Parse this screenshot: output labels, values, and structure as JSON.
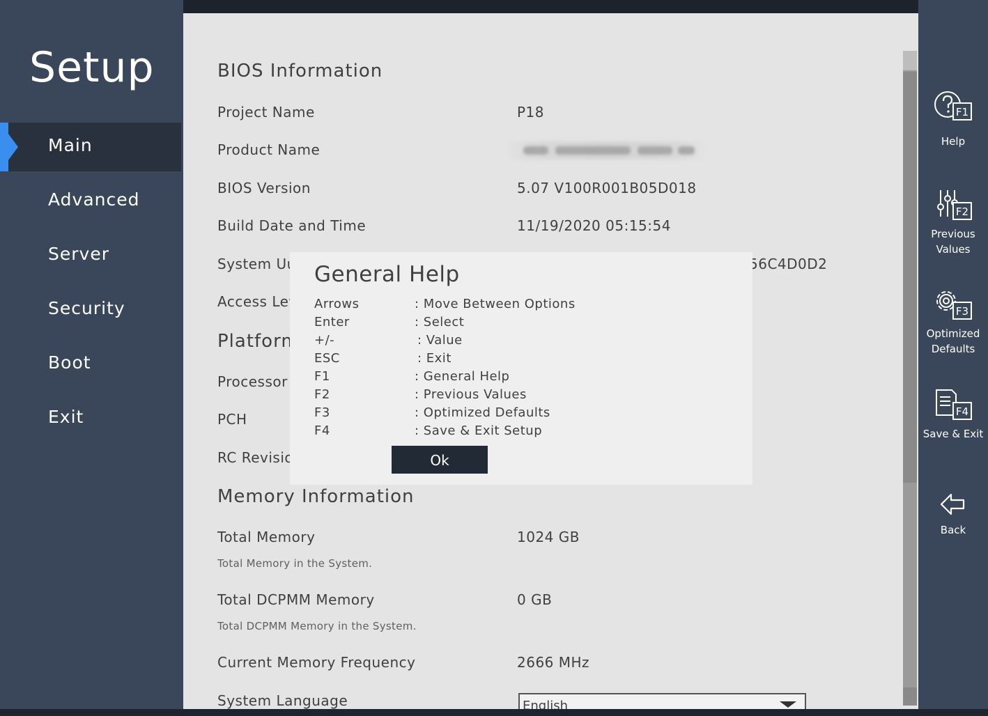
{
  "sidebar": {
    "title": "Setup",
    "items": [
      {
        "label": "Main",
        "active": true
      },
      {
        "label": "Advanced"
      },
      {
        "label": "Server"
      },
      {
        "label": "Security"
      },
      {
        "label": "Boot"
      },
      {
        "label": "Exit"
      }
    ]
  },
  "main": {
    "bios_section": "BIOS Information",
    "project_name_label": "Project Name",
    "project_name_value": "P18",
    "product_name_label": "Product Name",
    "bios_version_label": "BIOS Version",
    "bios_version_value": "5.07 V100R001B05D018",
    "build_date_label": "Build Date and Time",
    "build_date_value": "11/19/2020 05:15:54",
    "system_uuid_label": "System Uu",
    "system_uuid_value": "56C4D0D2",
    "access_level_label": "Access Lev",
    "platform_section": "Platform",
    "processor_label": "Processor",
    "pch_label": "PCH",
    "rc_revision_label": "RC Revisio",
    "memory_section": "Memory Information",
    "total_memory_label": "Total Memory",
    "total_memory_value": "1024 GB",
    "total_memory_desc": "Total Memory in the System.",
    "total_dcpmm_label": "Total DCPMM Memory",
    "total_dcpmm_value": "0 GB",
    "total_dcpmm_desc": "Total DCPMM Memory in the System.",
    "mem_freq_label": "Current Memory Frequency",
    "mem_freq_value": "2666 MHz",
    "language_label": "System Language",
    "language_value": "English"
  },
  "right_bar": {
    "help": "Help",
    "previous_values_1": "Previous",
    "previous_values_2": "Values",
    "optimized_defaults_1": "Optimized",
    "optimized_defaults_2": "Defaults",
    "save_exit": "Save & Exit",
    "back": "Back",
    "f1": "F1",
    "f2": "F2",
    "f3": "F3",
    "f4": "F4"
  },
  "dialog": {
    "title": "General Help",
    "rows": [
      {
        "key": "Arrows",
        "desc": ": Move Between Options"
      },
      {
        "key": "Enter",
        "desc": ": Select"
      },
      {
        "key": "+/-",
        "desc": ": Value"
      },
      {
        "key": "ESC",
        "desc": ": Exit"
      },
      {
        "key": "F1",
        "desc": ": General Help"
      },
      {
        "key": "F2",
        "desc": ": Previous Values"
      },
      {
        "key": "F3",
        "desc": ": Optimized Defaults"
      },
      {
        "key": "F4",
        "desc": ": Save & Exit Setup"
      }
    ],
    "ok_label": "Ok"
  },
  "colors": {
    "accent": "#3a8ef0",
    "sidebar_bg": "#3a4659",
    "content_bg": "#e4e4e4",
    "dialog_bg": "#efefef",
    "button_bg": "#222a35"
  }
}
